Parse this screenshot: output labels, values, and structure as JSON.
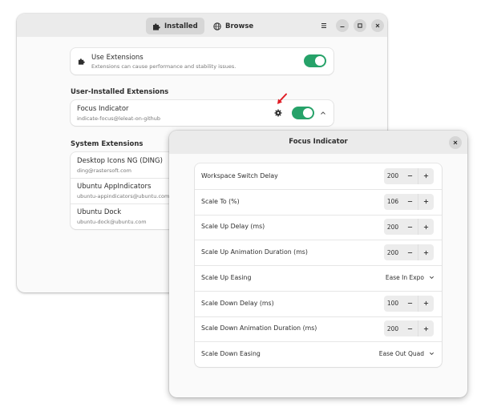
{
  "extensions_window": {
    "tabs": [
      {
        "label": "Installed",
        "icon": "puzzle-icon",
        "active": true
      },
      {
        "label": "Browse",
        "icon": "globe-icon",
        "active": false
      }
    ],
    "window_controls": [
      "menu-icon",
      "minimize-icon",
      "maximize-icon",
      "close-icon"
    ],
    "use_extensions": {
      "title": "Use Extensions",
      "subtitle": "Extensions can cause performance and stability issues.",
      "enabled": true
    },
    "user_installed": {
      "heading": "User-Installed Extensions",
      "items": [
        {
          "name": "Focus Indicator",
          "id": "indicate-focus@leleat-on-github",
          "enabled": true
        }
      ]
    },
    "system": {
      "heading": "System Extensions",
      "items": [
        {
          "name": "Desktop Icons NG (DING)",
          "id": "ding@rastersoft.com"
        },
        {
          "name": "Ubuntu AppIndicators",
          "id": "ubuntu-appindicators@ubuntu.com"
        },
        {
          "name": "Ubuntu Dock",
          "id": "ubuntu-dock@ubuntu.com"
        }
      ]
    }
  },
  "preferences_dialog": {
    "title": "Focus Indicator",
    "rows": [
      {
        "label": "Workspace Switch Delay",
        "type": "spin",
        "value": "200"
      },
      {
        "label": "Scale To (%)",
        "type": "spin",
        "value": "106"
      },
      {
        "label": "Scale Up Delay (ms)",
        "type": "spin",
        "value": "200"
      },
      {
        "label": "Scale Up Animation Duration (ms)",
        "type": "spin",
        "value": "200"
      },
      {
        "label": "Scale Up Easing",
        "type": "combo",
        "value": "Ease In Expo"
      },
      {
        "label": "Scale Down Delay (ms)",
        "type": "spin",
        "value": "100"
      },
      {
        "label": "Scale Down Animation Duration (ms)",
        "type": "spin",
        "value": "200"
      },
      {
        "label": "Scale Down Easing",
        "type": "combo",
        "value": "Ease Out Quad"
      }
    ]
  },
  "colors": {
    "switch_on": "#26a269",
    "annotation_arrow": "#e01b24",
    "headerbar": "#ebebeb",
    "window_bg": "#fafafa"
  }
}
